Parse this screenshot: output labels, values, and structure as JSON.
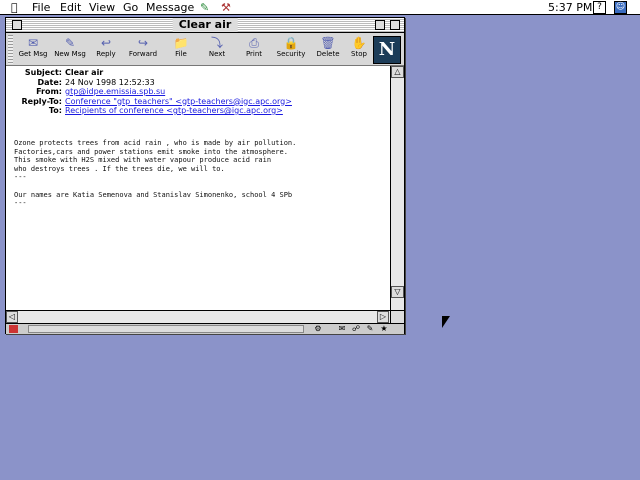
{
  "menubar": {
    "apple_icon": "apple-icon",
    "items": [
      "File",
      "Edit",
      "View",
      "Go",
      "Message"
    ],
    "clock": "5:37 PM",
    "help_icon": "help-icon",
    "app_icon": "finder-icon"
  },
  "window": {
    "title": "Clear air"
  },
  "toolbar": {
    "buttons": [
      {
        "label": "Get Msg",
        "icon": "get-msg-icon"
      },
      {
        "label": "New Msg",
        "icon": "new-msg-icon"
      },
      {
        "label": "Reply",
        "icon": "reply-icon"
      },
      {
        "label": "Forward",
        "icon": "forward-icon"
      },
      {
        "label": "File",
        "icon": "file-icon"
      },
      {
        "label": "Next",
        "icon": "next-icon"
      },
      {
        "label": "Print",
        "icon": "print-icon"
      },
      {
        "label": "Security",
        "icon": "security-icon"
      },
      {
        "label": "Delete",
        "icon": "delete-icon"
      },
      {
        "label": "Stop",
        "icon": "stop-icon"
      }
    ],
    "logo": "N"
  },
  "message": {
    "headers": [
      {
        "key": "Subject:",
        "value": "Clear air",
        "link": false,
        "bold": true
      },
      {
        "key": "Date:",
        "value": "24 Nov 1998 12:52:33",
        "link": false,
        "bold": false
      },
      {
        "key": "From:",
        "value": "gtp@idpe.emissia.spb.su",
        "link": true,
        "bold": false
      },
      {
        "key": "Reply-To:",
        "value": "Conference \"gtp_teachers\" <gtp-teachers@igc.apc.org>",
        "link": true,
        "bold": false
      },
      {
        "key": "To:",
        "value": "Recipients of conference <gtp-teachers@igc.apc.org>",
        "link": true,
        "bold": false
      }
    ],
    "body": "Ozone protects trees from acid rain , who is made by air pollution.\nFactories,cars and power stations emit smoke into the atmosphere.\nThis smoke with H2S mixed with water vapour produce acid rain\nwho destroys trees . If the trees die, we will to.\n---\n\nOur names are Katia Semenova and Stanislav Simonenko, school 4 SPb\n---"
  }
}
